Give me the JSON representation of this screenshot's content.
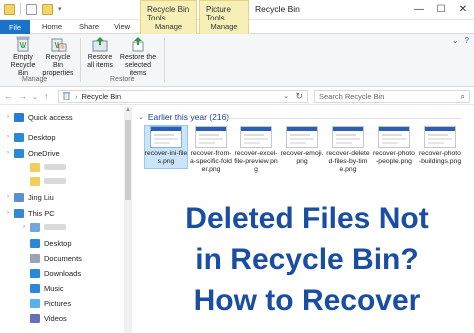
{
  "title_bar": {
    "window_title": "Recycle Bin",
    "contextual_tabs": [
      "Recycle Bin Tools",
      "Picture Tools"
    ],
    "controls": [
      "—",
      "☐",
      "✕"
    ]
  },
  "tabs": [
    {
      "label": "File"
    },
    {
      "label": "Home"
    },
    {
      "label": "Share"
    },
    {
      "label": "View"
    },
    {
      "label": "Manage"
    },
    {
      "label": "Manage"
    }
  ],
  "ribbon": {
    "buttons": [
      {
        "label": "Empty Recycle Bin",
        "icon": "empty-recycle-bin-icon"
      },
      {
        "label": "Recycle Bin properties",
        "icon": "recycle-bin-properties-icon"
      },
      {
        "label": "Restore all items",
        "icon": "restore-all-icon"
      },
      {
        "label": "Restore the selected items",
        "icon": "restore-selected-icon"
      }
    ],
    "groups": [
      "Manage",
      "Restore"
    ],
    "help_icons": [
      "⌄",
      "?"
    ]
  },
  "address_bar": {
    "path": "Recycle Bin",
    "search_placeholder": "Search Recycle Bin",
    "path_separator": "›"
  },
  "nav_pane": {
    "items": [
      {
        "label": "Quick access",
        "icon": "star-icon",
        "color": "#2a7bd4",
        "indent": 0
      },
      {
        "label": "Desktop",
        "icon": "desktop-icon",
        "color": "#2a88d8",
        "indent": 0
      },
      {
        "label": "OneDrive",
        "icon": "cloud-icon",
        "color": "#2a88d8",
        "indent": 0
      },
      {
        "label": "",
        "icon": "folder-icon",
        "color": "#f2cf5c",
        "indent": 1
      },
      {
        "label": "",
        "icon": "folder-icon",
        "color": "#f2cf5c",
        "indent": 1
      },
      {
        "label": "Jing Liu",
        "icon": "user-icon",
        "color": "#5b8fd1",
        "indent": 0
      },
      {
        "label": "This PC",
        "icon": "computer-icon",
        "color": "#3a86d1",
        "indent": 0
      },
      {
        "label": "",
        "icon": "drive-icon",
        "color": "#6fa8dc",
        "indent": 1
      },
      {
        "label": "Desktop",
        "icon": "desktop-icon",
        "color": "#2a88d8",
        "indent": 1
      },
      {
        "label": "Documents",
        "icon": "documents-icon",
        "color": "#9aa5b1",
        "indent": 1
      },
      {
        "label": "Downloads",
        "icon": "downloads-icon",
        "color": "#2a88d8",
        "indent": 1
      },
      {
        "label": "Music",
        "icon": "music-icon",
        "color": "#2a88d8",
        "indent": 1
      },
      {
        "label": "Pictures",
        "icon": "pictures-icon",
        "color": "#5ab0e8",
        "indent": 1
      },
      {
        "label": "Videos",
        "icon": "videos-icon",
        "color": "#6a6fb8",
        "indent": 1
      }
    ]
  },
  "content": {
    "group_header": "Earlier this year (216)",
    "files": [
      {
        "name": "recover-ini-files.png",
        "selected": true
      },
      {
        "name": "recover-from-a-specific-folder.png",
        "selected": false
      },
      {
        "name": "recover-excel-file-preview.png",
        "selected": false
      },
      {
        "name": "recover-emoji.png",
        "selected": false
      },
      {
        "name": "recover-deleted-files-by-time.png",
        "selected": false
      },
      {
        "name": "recover-photo-people.png",
        "selected": false
      },
      {
        "name": "recover-photo-buildings.png",
        "selected": false
      }
    ]
  },
  "overlay_text": {
    "line1": "Deleted Files Not",
    "line2": "in Recycle Bin?",
    "line3": "How to Recover",
    "color": "#1a4ea3"
  }
}
